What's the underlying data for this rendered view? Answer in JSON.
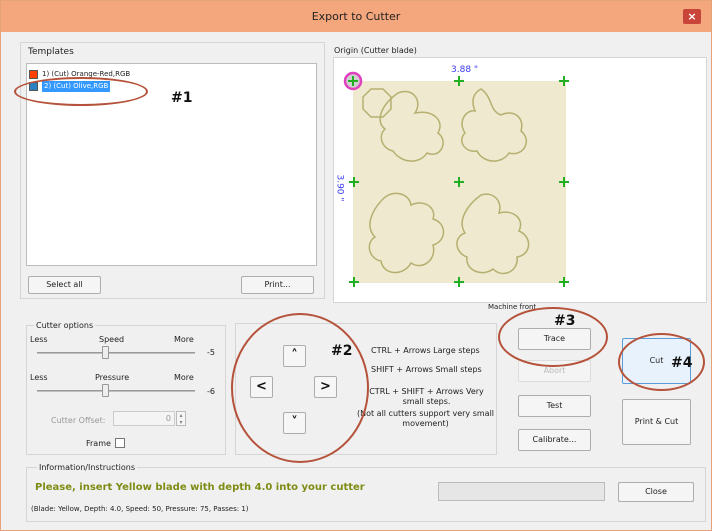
{
  "window": {
    "title": "Export to Cutter",
    "close_label": "×"
  },
  "templates": {
    "label": "Templates",
    "items": [
      {
        "label": "1) (Cut) Orange-Red,RGB",
        "color": "#ff4000"
      },
      {
        "label": "2) (Cut) Olive,RGB",
        "color": "#808000"
      }
    ],
    "select_all_label": "Select all",
    "print_label": "Print..."
  },
  "preview": {
    "label": "Origin (Cutter blade)",
    "width_label": "3.88 \"",
    "height_label": "3.90 \"",
    "footer_label": "Machine front"
  },
  "cutter_options": {
    "label": "Cutter options",
    "speed": {
      "less": "Less",
      "name": "Speed",
      "more": "More",
      "value": "-5",
      "level": 0.5
    },
    "pressure": {
      "less": "Less",
      "name": "Pressure",
      "more": "More",
      "value": "-6",
      "level": 0.5
    },
    "offset_label": "Cutter Offset:",
    "offset_value": "0",
    "frame_label": "Frame",
    "frame_checked": false
  },
  "move": {
    "up": "˄",
    "down": "˅",
    "left": "<",
    "right": ">",
    "help1": "CTRL + Arrows  Large steps",
    "help2": "SHIFT + Arrows  Small steps",
    "help3": "CTRL + SHIFT + Arrows  Very small steps.",
    "help4": "(Not all cutters support very small movement)"
  },
  "actions": {
    "trace": "Trace",
    "abort": "Abort",
    "test": "Test",
    "calibrate": "Calibrate...",
    "cut": "Cut",
    "print_cut": "Print & Cut",
    "close": "Close"
  },
  "info": {
    "label": "Information/Instructions",
    "message": "Please, insert Yellow blade with depth 4.0 into your cutter",
    "details": "(Blade: Yellow,  Depth: 4.0, Speed: 50, Pressure: 75, Passes: 1)"
  },
  "annotations": {
    "a1": "#1",
    "a2": "#2",
    "a3": "#3",
    "a4": "#4"
  },
  "colors": {
    "annotation": "#b5523a",
    "marker": "#22b022",
    "dimension": "#3a3af0",
    "cut_line": "#b5b070",
    "origin": "#e040c0"
  }
}
